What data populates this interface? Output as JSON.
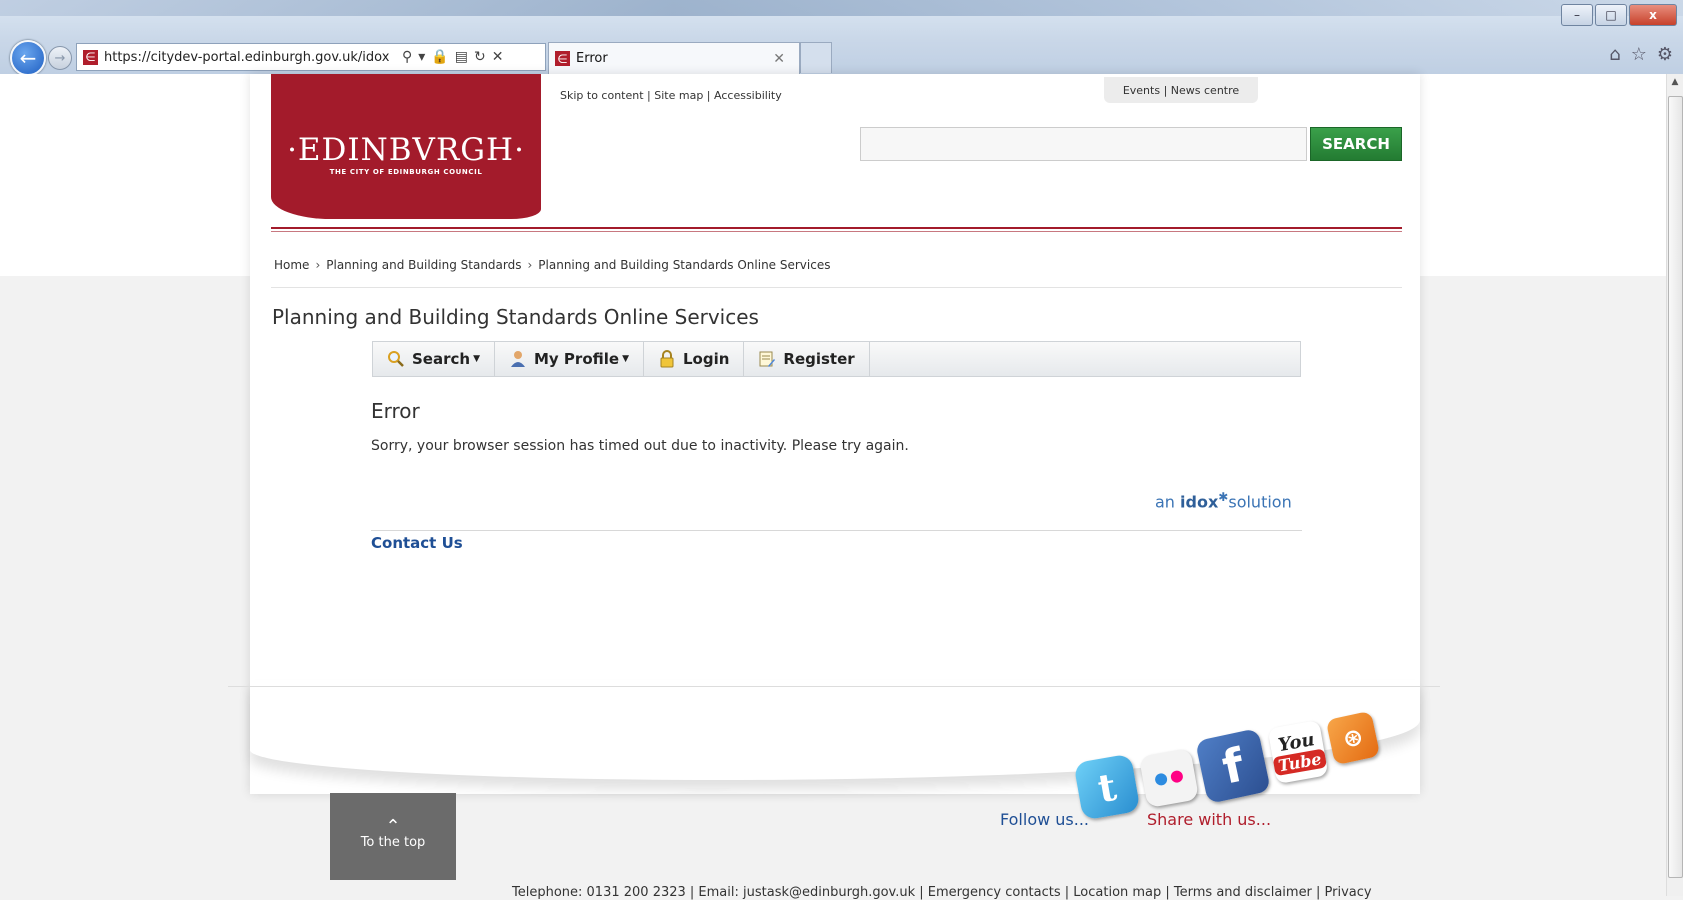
{
  "browser": {
    "url": "https://citydev-portal.edinburgh.gov.uk/idox",
    "tab_title": "Error",
    "win_min": "–",
    "win_max": "□",
    "win_close": "x"
  },
  "header": {
    "logo_main": "·EDINBVRGH·",
    "logo_sub": "THE CITY OF EDINBURGH COUNCIL",
    "skip_links": [
      "Skip to content",
      "Site map",
      "Accessibility"
    ],
    "top_links": [
      "Events",
      "News centre"
    ],
    "search_button": "SEARCH",
    "search_placeholder": ""
  },
  "breadcrumb": [
    "Home",
    "Planning and Building Standards",
    "Planning and Building Standards Online Services"
  ],
  "page_title": "Planning and Building Standards Online Services",
  "nav": {
    "items": [
      "Search",
      "My Profile",
      "Login",
      "Register"
    ]
  },
  "error": {
    "title": "Error",
    "message": "Sorry, your browser session has timed out due to inactivity. Please try again."
  },
  "idox": {
    "pre": "an",
    "brand": "idox",
    "post": "solution"
  },
  "contact_us": "Contact Us",
  "footer": {
    "to_top": "To the top",
    "follow_us": "Follow us...",
    "share_with_us": "Share with us...",
    "contact_line": "Telephone: 0131 200 2323 | Email: justask@edinburgh.gov.uk | Emergency contacts | Location map | Terms and disclaimer | Privacy"
  },
  "colors": {
    "brand_red": "#a31b2b",
    "search_green": "#2f8f3e",
    "link_blue": "#1f4f95"
  }
}
